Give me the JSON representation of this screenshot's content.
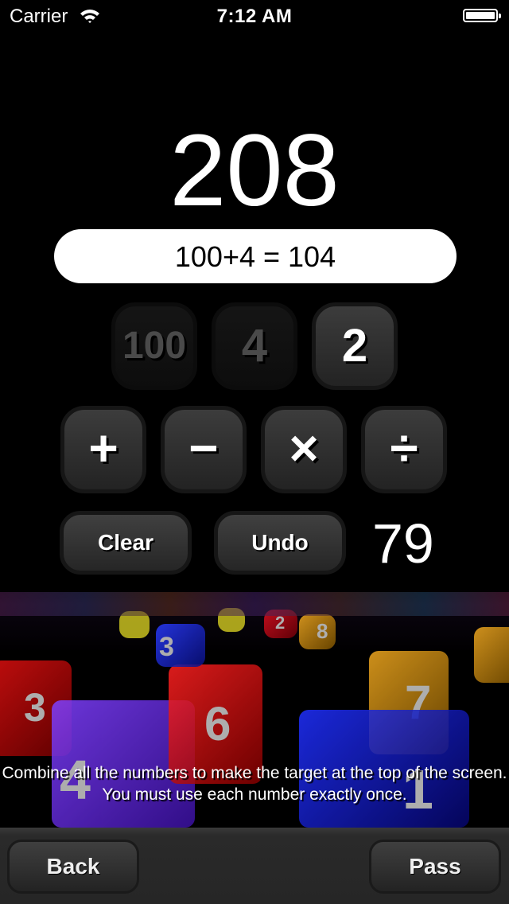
{
  "status_bar": {
    "carrier": "Carrier",
    "time": "7:12 AM",
    "battery_level": 1.0
  },
  "game": {
    "target": "208",
    "expression": "100+4 = 104",
    "numbers": [
      {
        "value": "100",
        "used": true
      },
      {
        "value": "4",
        "used": true
      },
      {
        "value": "2",
        "used": false
      }
    ],
    "operators": [
      {
        "name": "add",
        "symbol": "+"
      },
      {
        "name": "subtract",
        "symbol": "−"
      },
      {
        "name": "multiply",
        "symbol": "×"
      },
      {
        "name": "divide",
        "symbol": "÷"
      }
    ],
    "clear_label": "Clear",
    "undo_label": "Undo",
    "remaining": "79",
    "hint": "Combine all the numbers to make the target at the top of the screen. You must use each number exactly once."
  },
  "background_dice": [
    {
      "digit": "3",
      "color": "#c00000"
    },
    {
      "digit": "4",
      "color": "#6a1fd0"
    },
    {
      "digit": "6",
      "color": "#c00000"
    },
    {
      "digit": "7",
      "color": "#d89000"
    },
    {
      "digit": "1",
      "color": "#1010c8"
    },
    {
      "digit": "3",
      "color": "#1a2ad0"
    },
    {
      "digit": "8",
      "color": "#d89000"
    },
    {
      "digit": "2",
      "color": "#b00010"
    }
  ],
  "toolbar": {
    "back_label": "Back",
    "pass_label": "Pass"
  }
}
